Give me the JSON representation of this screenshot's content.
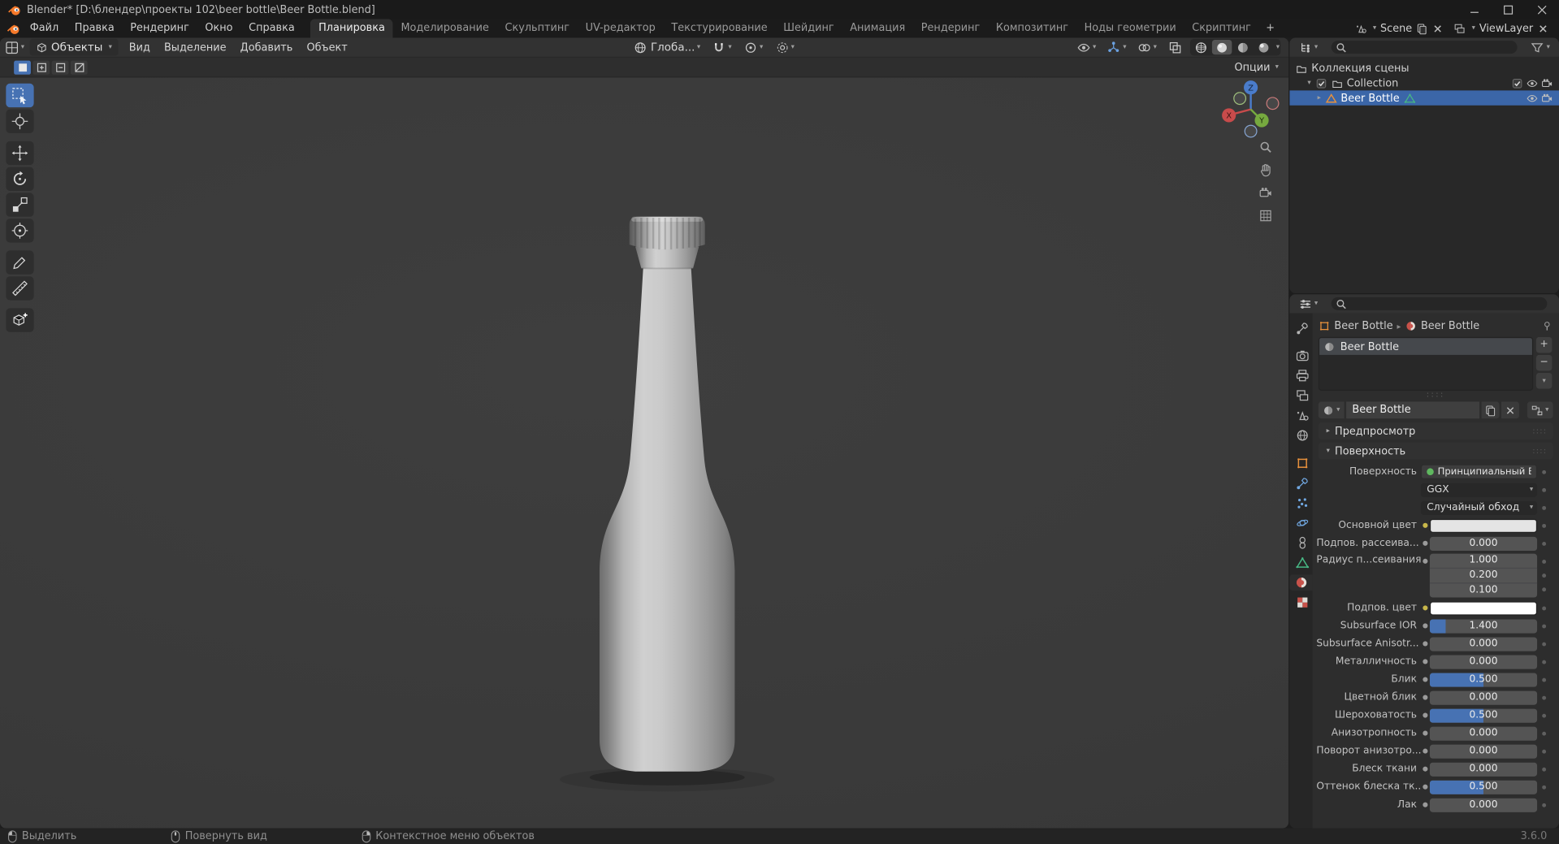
{
  "window": {
    "title": "Blender* [D:\\блендер\\проекты 102\\beer bottle\\Beer Bottle.blend]"
  },
  "topbar": {
    "menus": [
      {
        "id": "file",
        "label": "Файл"
      },
      {
        "id": "edit",
        "label": "Правка"
      },
      {
        "id": "render",
        "label": "Рендеринг"
      },
      {
        "id": "window",
        "label": "Окно"
      },
      {
        "id": "help",
        "label": "Справка"
      }
    ],
    "tabs": [
      {
        "id": "layout",
        "label": "Планировка",
        "active": true
      },
      {
        "id": "modeling",
        "label": "Моделирование",
        "active": false
      },
      {
        "id": "sculpting",
        "label": "Скульптинг",
        "active": false
      },
      {
        "id": "uv-editor",
        "label": "UV-редактор",
        "active": false
      },
      {
        "id": "texture-paint",
        "label": "Текстурирование",
        "active": false
      },
      {
        "id": "shading",
        "label": "Шейдинг",
        "active": false
      },
      {
        "id": "animation",
        "label": "Анимация",
        "active": false
      },
      {
        "id": "rendering",
        "label": "Рендеринг",
        "active": false
      },
      {
        "id": "compositing",
        "label": "Композитинг",
        "active": false
      },
      {
        "id": "geometry-nodes",
        "label": "Ноды геометрии",
        "active": false
      },
      {
        "id": "scripting",
        "label": "Скриптинг",
        "active": false
      }
    ],
    "add_tab_label": "+",
    "scene_name": "Scene",
    "view_layer_name": "ViewLayer"
  },
  "viewport": {
    "mode_label": "Объекты",
    "menus": [
      {
        "id": "view",
        "label": "Вид"
      },
      {
        "id": "select",
        "label": "Выделение"
      },
      {
        "id": "add",
        "label": "Добавить"
      },
      {
        "id": "object",
        "label": "Объект"
      }
    ],
    "orientation_label": "Глоба...",
    "options_label": "Опции"
  },
  "outliner": {
    "scene_collection_label": "Коллекция сцены",
    "collection_label": "Collection",
    "object_label": "Beer Bottle"
  },
  "properties": {
    "breadcrumb_object": "Beer Bottle",
    "breadcrumb_material": "Beer Bottle",
    "slot_name": "Beer Bottle",
    "material_name": "Beer Bottle",
    "preview_section": "Предпросмотр",
    "surface_section": "Поверхность",
    "rows": [
      {
        "id": "surface-shader",
        "label": "Поверхность",
        "type": "shader",
        "value": "Принципиальный BSDF",
        "socket": "none"
      },
      {
        "id": "distribution",
        "label": "",
        "type": "dropdown",
        "value": "GGX",
        "socket": "none"
      },
      {
        "id": "subsurface-method",
        "label": "",
        "type": "dropdown",
        "value": "Случайный обход",
        "socket": "none"
      },
      {
        "id": "base-color",
        "label": "Основной цвет",
        "type": "color",
        "value": "#e4e4e4",
        "socket": "yellow"
      },
      {
        "id": "subsurface",
        "label": "Подпов. рассеива...",
        "type": "slider",
        "value": "0.000",
        "fill": 0,
        "socket": "gray"
      },
      {
        "id": "subsurface-radius",
        "label": "Радиус п...сеивания",
        "type": "stack",
        "values": [
          "1.000",
          "0.200",
          "0.100"
        ],
        "socket": "gray"
      },
      {
        "id": "subsurface-color",
        "label": "Подпов. цвет",
        "type": "color",
        "value": "#ffffff",
        "socket": "yellow"
      },
      {
        "id": "subsurface-ior",
        "label": "Subsurface IOR",
        "type": "slider",
        "value": "1.400",
        "fill": 0.15,
        "socket": "gray"
      },
      {
        "id": "subsurface-anisotropy",
        "label": "Subsurface Anisotr...",
        "type": "slider",
        "value": "0.000",
        "fill": 0,
        "socket": "gray"
      },
      {
        "id": "metallic",
        "label": "Металличность",
        "type": "slider",
        "value": "0.000",
        "fill": 0,
        "socket": "gray"
      },
      {
        "id": "specular",
        "label": "Блик",
        "type": "slider",
        "value": "0.500",
        "fill": 0.5,
        "socket": "gray"
      },
      {
        "id": "specular-tint",
        "label": "Цветной блик",
        "type": "slider",
        "value": "0.000",
        "fill": 0,
        "socket": "gray"
      },
      {
        "id": "roughness",
        "label": "Шероховатость",
        "type": "slider",
        "value": "0.500",
        "fill": 0.5,
        "socket": "gray"
      },
      {
        "id": "anisotropic",
        "label": "Анизотропность",
        "type": "slider",
        "value": "0.000",
        "fill": 0,
        "socket": "gray"
      },
      {
        "id": "anisotropic-rotation",
        "label": "Поворот анизотро...",
        "type": "slider",
        "value": "0.000",
        "fill": 0,
        "socket": "gray"
      },
      {
        "id": "sheen",
        "label": "Блеск ткани",
        "type": "slider",
        "value": "0.000",
        "fill": 0,
        "socket": "gray"
      },
      {
        "id": "sheen-tint",
        "label": "Оттенок блеска тк...",
        "type": "slider",
        "value": "0.500",
        "fill": 0.5,
        "socket": "gray"
      },
      {
        "id": "clearcoat",
        "label": "Лак",
        "type": "slider",
        "value": "0.000",
        "fill": 0,
        "socket": "gray"
      }
    ]
  },
  "status_bar": {
    "items": [
      {
        "id": "select",
        "label": "Выделить",
        "button": "left"
      },
      {
        "id": "rotate-view",
        "label": "Повернуть вид",
        "button": "middle"
      },
      {
        "id": "object-context-menu",
        "label": "Контекстное меню объектов",
        "button": "right"
      }
    ],
    "version": "3.6.0"
  },
  "colors": {
    "accent": "#4772b3",
    "selection": "#3b66a8",
    "viewport_bg": "#3b3b3b"
  }
}
